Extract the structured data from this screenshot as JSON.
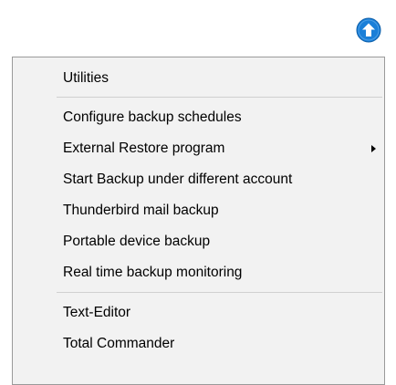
{
  "toolbar": {
    "up_icon": "arrow-up-circle-icon",
    "up_color": "#1a7fd8"
  },
  "menu": {
    "items": [
      {
        "label": "Utilities"
      },
      {
        "label": "Configure backup schedules"
      },
      {
        "label": "External Restore program",
        "has_submenu": true
      },
      {
        "label": "Start Backup under different account"
      },
      {
        "label": "Thunderbird mail backup"
      },
      {
        "label": "Portable device backup"
      },
      {
        "label": "Real time backup monitoring"
      },
      {
        "label": "Text-Editor"
      },
      {
        "label": "Total Commander"
      }
    ]
  }
}
